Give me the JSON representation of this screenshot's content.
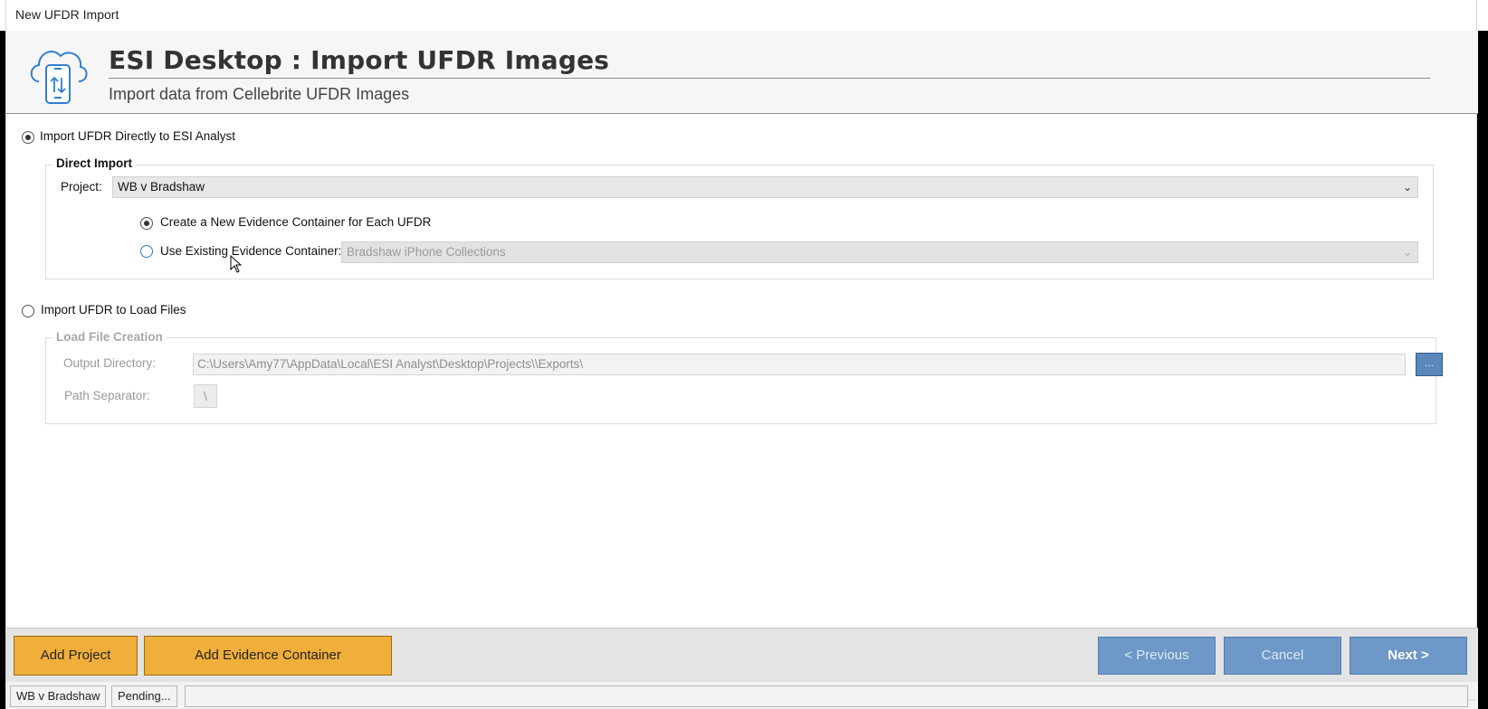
{
  "window": {
    "title": "New UFDR Import"
  },
  "header": {
    "title": "ESI Desktop : Import UFDR Images",
    "subtitle": "Import data from Cellebrite UFDR Images",
    "icon": "cloud-phone-sync-icon"
  },
  "option_direct": {
    "label": "Import UFDR Directly to ESI Analyst",
    "selected": true,
    "group_title": "Direct Import",
    "project_label": "Project:",
    "project_value": "WB v Bradshaw",
    "new_container_label": "Create a New Evidence Container for Each UFDR",
    "new_container_selected": true,
    "existing_container_label": "Use Existing Evidence Container:",
    "existing_container_value": "Bradshaw iPhone Collections"
  },
  "option_loadfile": {
    "label": "Import UFDR to Load Files",
    "selected": false,
    "group_title": "Load File Creation",
    "output_dir_label": "Output Directory:",
    "output_dir_value": "C:\\Users\\Amy77\\AppData\\Local\\ESI Analyst\\Desktop\\Projects\\\\Exports\\",
    "browse_label": "...",
    "path_sep_label": "Path Separator:",
    "path_sep_value": "\\"
  },
  "footer": {
    "add_project": "Add Project",
    "add_evidence": "Add Evidence Container",
    "previous": "< Previous",
    "cancel": "Cancel",
    "next": "Next >"
  },
  "statusbar": {
    "project": "WB v Bradshaw",
    "status": "Pending..."
  },
  "colors": {
    "orange_button": "#f0af3a",
    "blue_button": "#6d98c7",
    "icon_blue": "#2f7fd0"
  }
}
